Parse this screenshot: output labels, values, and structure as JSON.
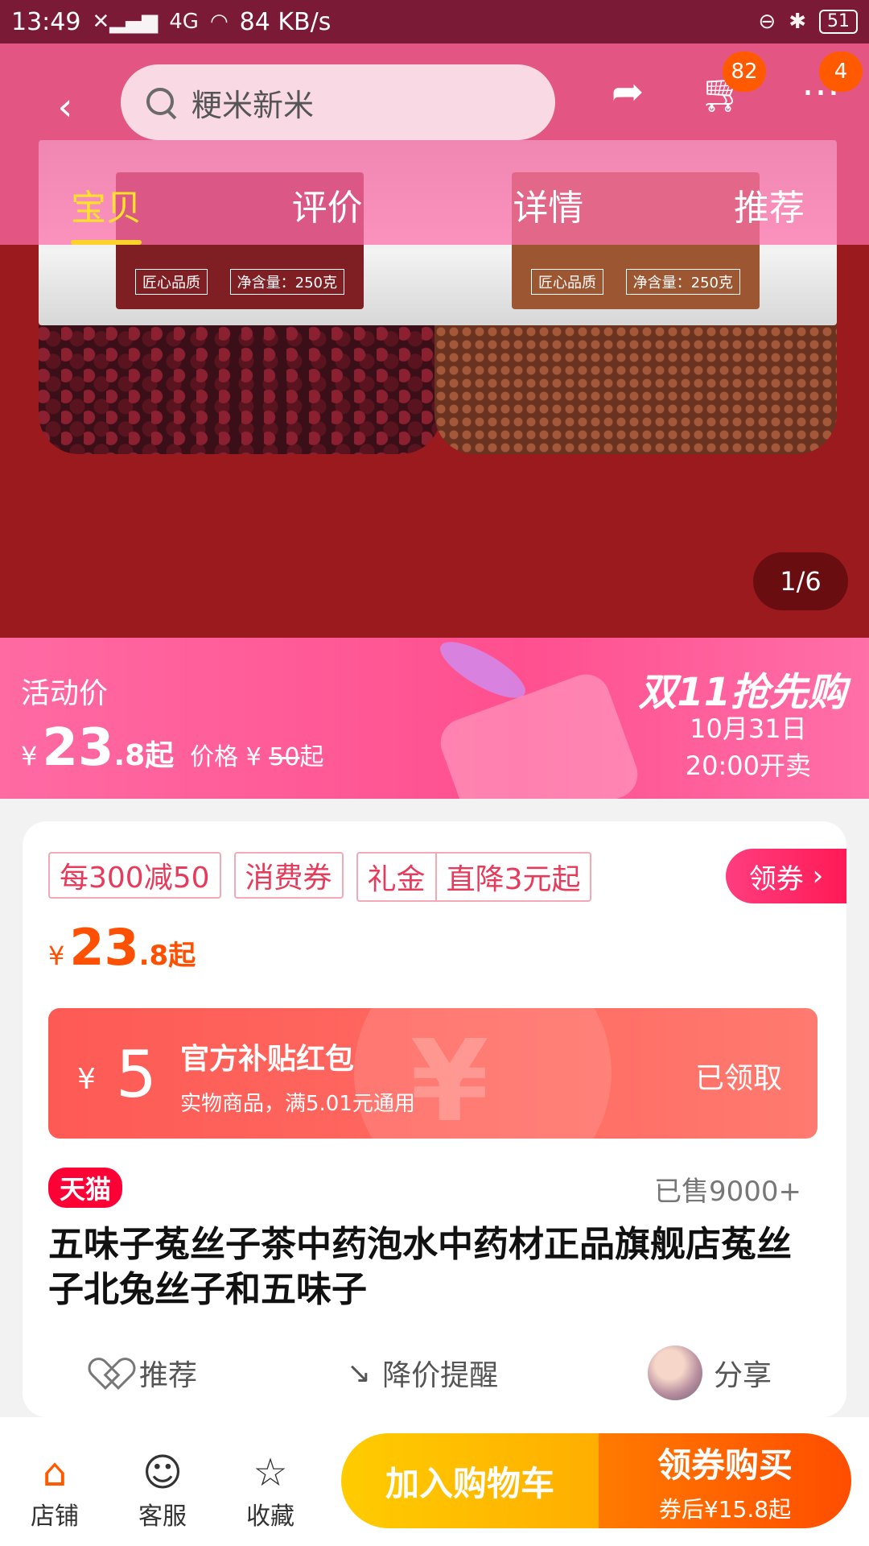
{
  "status_bar": {
    "time": "13:49",
    "network_speed": "84 KB/s",
    "battery": "51",
    "network_label": "4G"
  },
  "nav": {
    "search_placeholder": "粳米新米",
    "cart_badge": "82",
    "more_badge": "4",
    "tabs": [
      {
        "label": "宝贝",
        "active": true
      },
      {
        "label": "评价",
        "active": false
      },
      {
        "label": "详情",
        "active": false
      },
      {
        "label": "推荐",
        "active": false
      }
    ]
  },
  "hero": {
    "pager": "1/6",
    "jar_left": {
      "tag1": "匠心品质",
      "tag2": "净含量：250克"
    },
    "jar_right": {
      "tag1": "匠心品质",
      "tag2": "净含量：250克"
    }
  },
  "promo": {
    "label": "活动价",
    "currency": "¥",
    "price_int": "23",
    "price_dec": ".8起",
    "orig_prefix": "价格 ¥",
    "orig_price": "50",
    "orig_suffix": "起",
    "event_name": "双11抢先购",
    "event_date": "10月31日",
    "event_time": "20:00开卖"
  },
  "card": {
    "coupons": [
      "每300减50",
      "消费券"
    ],
    "coupon_group": [
      "礼金",
      "直降3元起"
    ],
    "get_coupon": "领券",
    "price": {
      "currency": "¥",
      "int": "23",
      "dec": ".8起"
    },
    "redpack": {
      "currency": "¥",
      "amount": "5",
      "title": "官方补贴红包",
      "subtitle": "实物商品，满5.01元通用",
      "state": "已领取"
    },
    "store_badge": "天猫",
    "sold": "已售9000+",
    "title": "五味子菟丝子茶中药泡水中药材正品旗舰店菟丝子北兔丝子和五味子",
    "actions": {
      "recommend": "推荐",
      "price_alert": "降价提醒",
      "share": "分享"
    }
  },
  "bottom": {
    "shop": "店铺",
    "service": "客服",
    "favorite": "收藏",
    "add_cart": "加入购物车",
    "buy_main": "领券购买",
    "buy_sub": "券后¥15.8起"
  },
  "colors": {
    "accent_orange": "#ff5a00",
    "tab_active": "#ffe12a",
    "tmall_red": "#ff0036",
    "promo_pink": "#ff4f8f"
  }
}
